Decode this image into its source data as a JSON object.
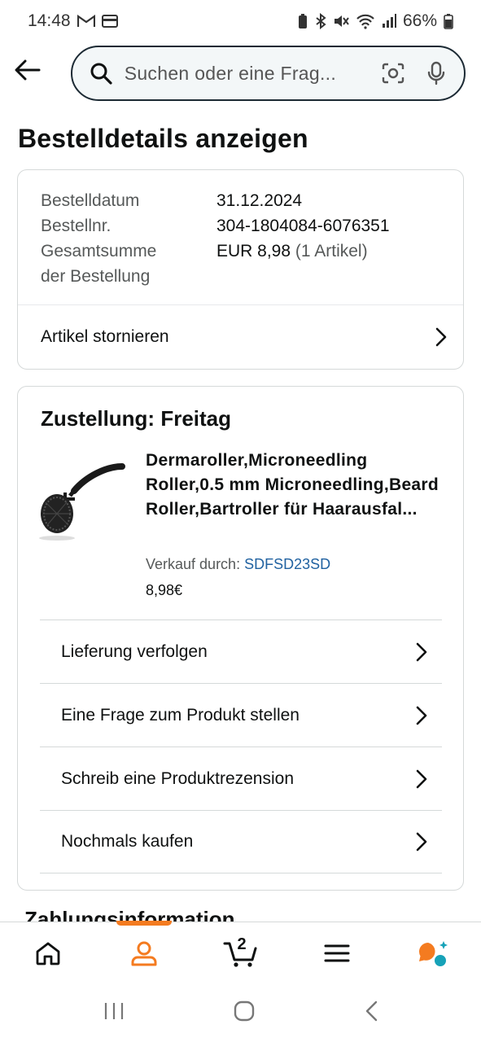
{
  "status": {
    "time": "14:48",
    "battery": "66%"
  },
  "search": {
    "placeholder": "Suchen oder eine Frag..."
  },
  "page": {
    "title": "Bestelldetails anzeigen"
  },
  "order": {
    "date_label": "Bestelldatum",
    "date_value": "31.12.2024",
    "number_label": "Bestellnr.",
    "number_value": "304-1804084-6076351",
    "total_label_1": "Gesamtsumme",
    "total_label_2": "der Bestellung",
    "total_value": "EUR 8,98",
    "total_items": "(1 Artikel)",
    "cancel_label": "Artikel stornieren"
  },
  "delivery": {
    "title": "Zustellung: Freitag",
    "product_title": "Dermaroller,Microneedling Roller,0.5 mm Microneedling,Beard Roller,Bartroller für Haarausfal...",
    "seller_label": "Verkauf durch:",
    "seller_name": "SDFSD23SD",
    "price": "8,98€",
    "actions": [
      {
        "label": "Lieferung verfolgen"
      },
      {
        "label": "Eine Frage zum Produkt stellen"
      },
      {
        "label": "Schreib eine Produktrezension"
      },
      {
        "label": "Nochmals kaufen"
      }
    ]
  },
  "next_section": {
    "title": "Zahlungsinformation"
  },
  "bottom_nav": {
    "cart_count": "2",
    "active": "account",
    "accent_color": "#f47b20"
  },
  "icons": [
    "back-arrow-icon",
    "search-icon",
    "camera-icon",
    "microphone-icon",
    "chevron-right-icon",
    "home-icon",
    "account-icon",
    "cart-icon",
    "menu-icon",
    "rufus-chat-icon"
  ]
}
